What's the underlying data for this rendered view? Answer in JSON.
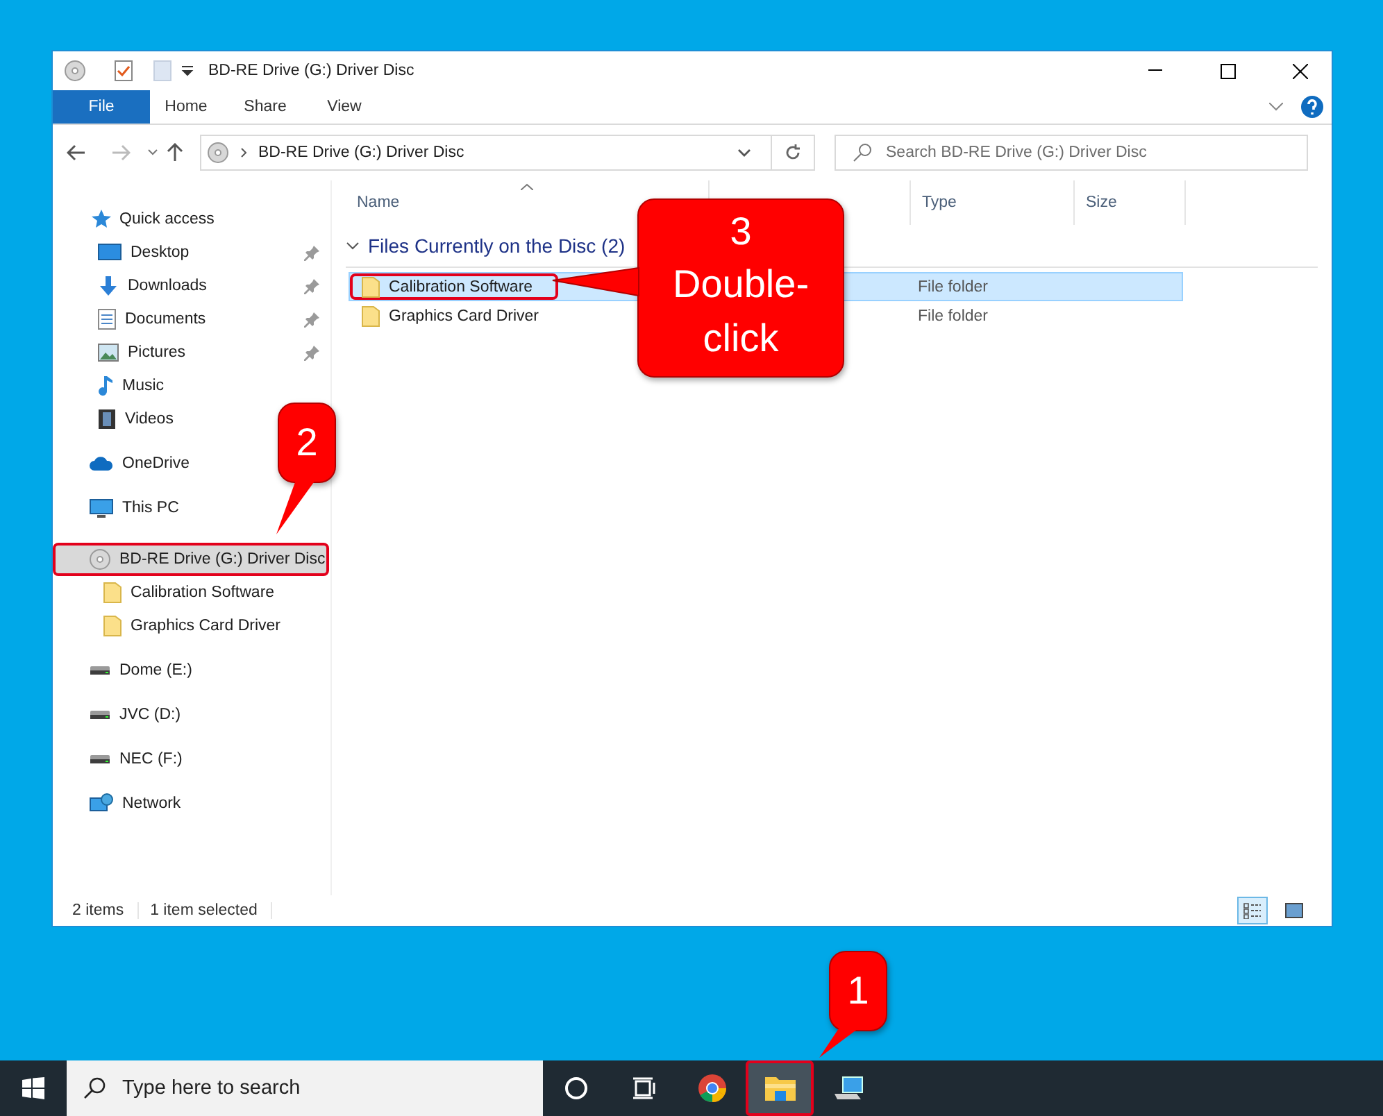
{
  "window": {
    "title": "BD-RE Drive (G:) Driver Disc"
  },
  "ribbon_tabs": [
    {
      "label": "File",
      "selected": true
    },
    {
      "label": "Home",
      "selected": false
    },
    {
      "label": "Share",
      "selected": false
    },
    {
      "label": "View",
      "selected": false
    }
  ],
  "address": {
    "path": "BD-RE Drive (G:) Driver Disc"
  },
  "search": {
    "placeholder": "Search BD-RE Drive (G:) Driver Disc"
  },
  "sidebar": {
    "items": [
      {
        "label": "Quick access",
        "kind": "star",
        "selected": false,
        "highlighted": false,
        "children": [
          {
            "label": "Desktop",
            "kind": "desktop",
            "pinned": true,
            "selected": false,
            "highlighted": false
          },
          {
            "label": "Downloads",
            "kind": "download",
            "pinned": true,
            "selected": false,
            "highlighted": false
          },
          {
            "label": "Documents",
            "kind": "document",
            "pinned": true,
            "selected": false,
            "highlighted": false
          },
          {
            "label": "Pictures",
            "kind": "pictures",
            "pinned": true,
            "selected": false,
            "highlighted": false
          },
          {
            "label": "Music",
            "kind": "music",
            "pinned": false,
            "selected": false,
            "highlighted": false
          },
          {
            "label": "Videos",
            "kind": "video",
            "pinned": false,
            "selected": false,
            "highlighted": false
          }
        ]
      },
      {
        "label": "OneDrive",
        "kind": "cloud",
        "selected": false,
        "highlighted": false
      },
      {
        "label": "This PC",
        "kind": "pc",
        "selected": false,
        "highlighted": false
      },
      {
        "label": "BD-RE Drive (G:) Driver Disc",
        "kind": "disc",
        "selected": true,
        "highlighted": true,
        "children": [
          {
            "label": "Calibration Software",
            "kind": "folder",
            "pinned": false,
            "selected": false,
            "highlighted": false
          },
          {
            "label": "Graphics Card Driver",
            "kind": "folder",
            "pinned": false,
            "selected": false,
            "highlighted": false
          }
        ]
      },
      {
        "label": "Dome (E:)",
        "kind": "drive",
        "selected": false,
        "highlighted": false
      },
      {
        "label": "JVC (D:)",
        "kind": "drive",
        "selected": false,
        "highlighted": false
      },
      {
        "label": "NEC (F:)",
        "kind": "drive",
        "selected": false,
        "highlighted": false
      },
      {
        "label": "Network",
        "kind": "network",
        "selected": false,
        "highlighted": false
      }
    ]
  },
  "columns": [
    {
      "label": "Name",
      "sorted": true
    },
    {
      "label": "Type",
      "sorted": false
    },
    {
      "label": "Size",
      "sorted": false
    }
  ],
  "group": {
    "label": "Files Currently on the Disc (2)",
    "expanded": true
  },
  "rows": [
    {
      "name": "Calibration Software",
      "type": "File folder",
      "selected": true,
      "highlighted": true
    },
    {
      "name": "Graphics Card Driver",
      "type": "File folder",
      "selected": false,
      "highlighted": false
    }
  ],
  "status_bar": {
    "count": "2 items",
    "selection": "1 item selected"
  },
  "view_buttons": [
    {
      "kind": "details",
      "selected": true
    },
    {
      "kind": "large",
      "selected": false
    }
  ],
  "taskbar": {
    "search_placeholder": "Type here to search",
    "apps": [
      {
        "kind": "cortana",
        "active": false,
        "highlighted": false
      },
      {
        "kind": "taskview",
        "active": false,
        "highlighted": false
      },
      {
        "kind": "chrome",
        "active": false,
        "highlighted": false
      },
      {
        "kind": "explorer",
        "active": true,
        "highlighted": true
      },
      {
        "kind": "network",
        "active": false,
        "highlighted": false
      }
    ]
  },
  "callouts": [
    {
      "number": "1"
    },
    {
      "number": "2"
    },
    {
      "number": "3",
      "label": "Double-click"
    }
  ]
}
